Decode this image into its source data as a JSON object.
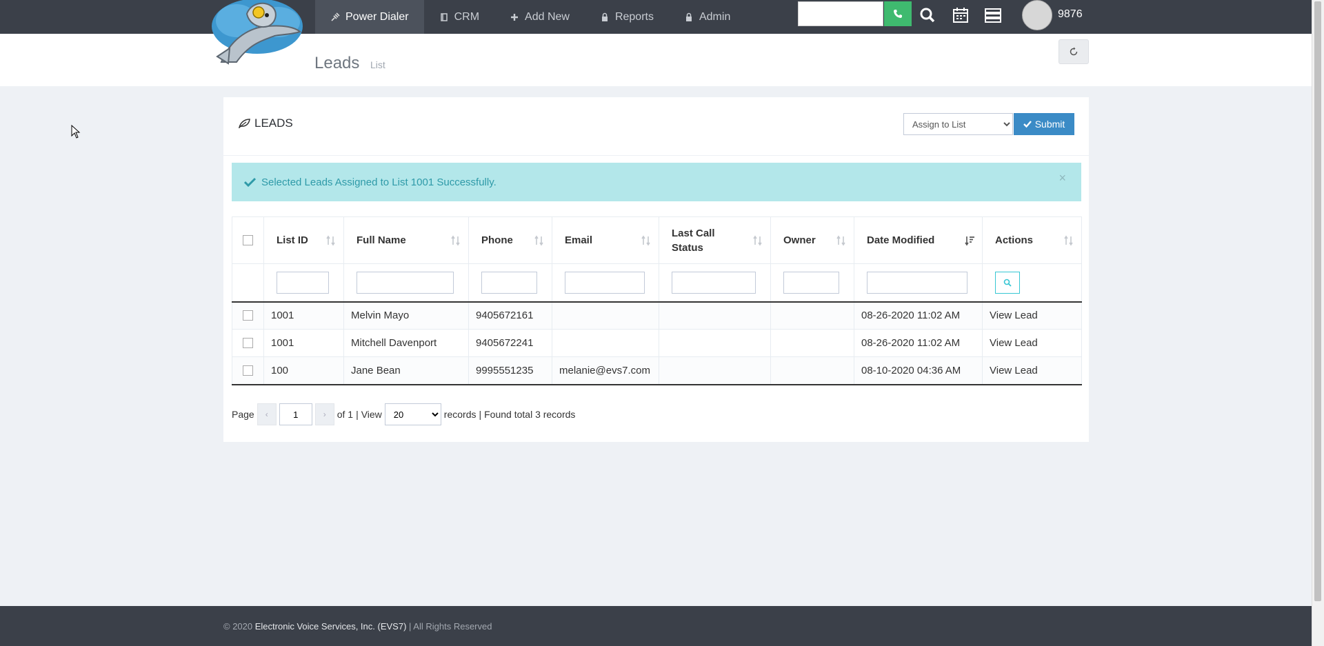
{
  "nav": {
    "items": [
      {
        "label": "Power Dialer",
        "icon": "plug-icon"
      },
      {
        "label": "CRM",
        "icon": "book-icon"
      },
      {
        "label": "Add New",
        "icon": "plus-icon"
      },
      {
        "label": "Reports",
        "icon": "lock-icon"
      },
      {
        "label": "Admin",
        "icon": "lock-icon"
      }
    ],
    "active_index": 0,
    "search_placeholder": "",
    "extension": "9876"
  },
  "header": {
    "title": "Leads",
    "subtitle": "List"
  },
  "portlet": {
    "title": "LEADS",
    "assign_select": {
      "selected": "Assign to List",
      "options": [
        "Assign to List"
      ]
    },
    "submit_label": "Submit"
  },
  "alert": {
    "message": "Selected Leads Assigned to List 1001 Successfully.",
    "close": "×"
  },
  "table": {
    "columns": [
      "List ID",
      "Full Name",
      "Phone",
      "Email",
      "Last Call Status",
      "Owner",
      "Date Modified",
      "Actions"
    ],
    "sorted_column": "Date Modified",
    "rows": [
      {
        "list_id": "1001",
        "full_name": "Melvin Mayo",
        "phone": "9405672161",
        "email": "",
        "last_call_status": "",
        "owner": "",
        "date_modified": "08-26-2020 11:02 AM",
        "action": "View Lead"
      },
      {
        "list_id": "1001",
        "full_name": "Mitchell Davenport",
        "phone": "9405672241",
        "email": "",
        "last_call_status": "",
        "owner": "",
        "date_modified": "08-26-2020 11:02 AM",
        "action": "View Lead"
      },
      {
        "list_id": "100",
        "full_name": "Jane Bean",
        "phone": "9995551235",
        "email": "melanie@evs7.com",
        "last_call_status": "",
        "owner": "",
        "date_modified": "08-10-2020 04:36 AM",
        "action": "View Lead"
      }
    ]
  },
  "pagination": {
    "page_label": "Page",
    "page_value": "1",
    "of_label": "of 1",
    "view_label": "View",
    "per_page": "20",
    "per_page_options": [
      "20"
    ],
    "records_label": "records",
    "found_label": "Found total 3 records"
  },
  "footer": {
    "copyright": "© 2020",
    "company": "Electronic Voice Services, Inc. (EVS7)",
    "rights": "| All Rights Reserved"
  },
  "colors": {
    "navbar": "#3b4049",
    "accent_blue": "#3b8bc6",
    "call_green": "#3fba6f",
    "alert_bg": "#b3e7ea",
    "alert_text": "#2e9aa8",
    "link": "#337ab7"
  }
}
